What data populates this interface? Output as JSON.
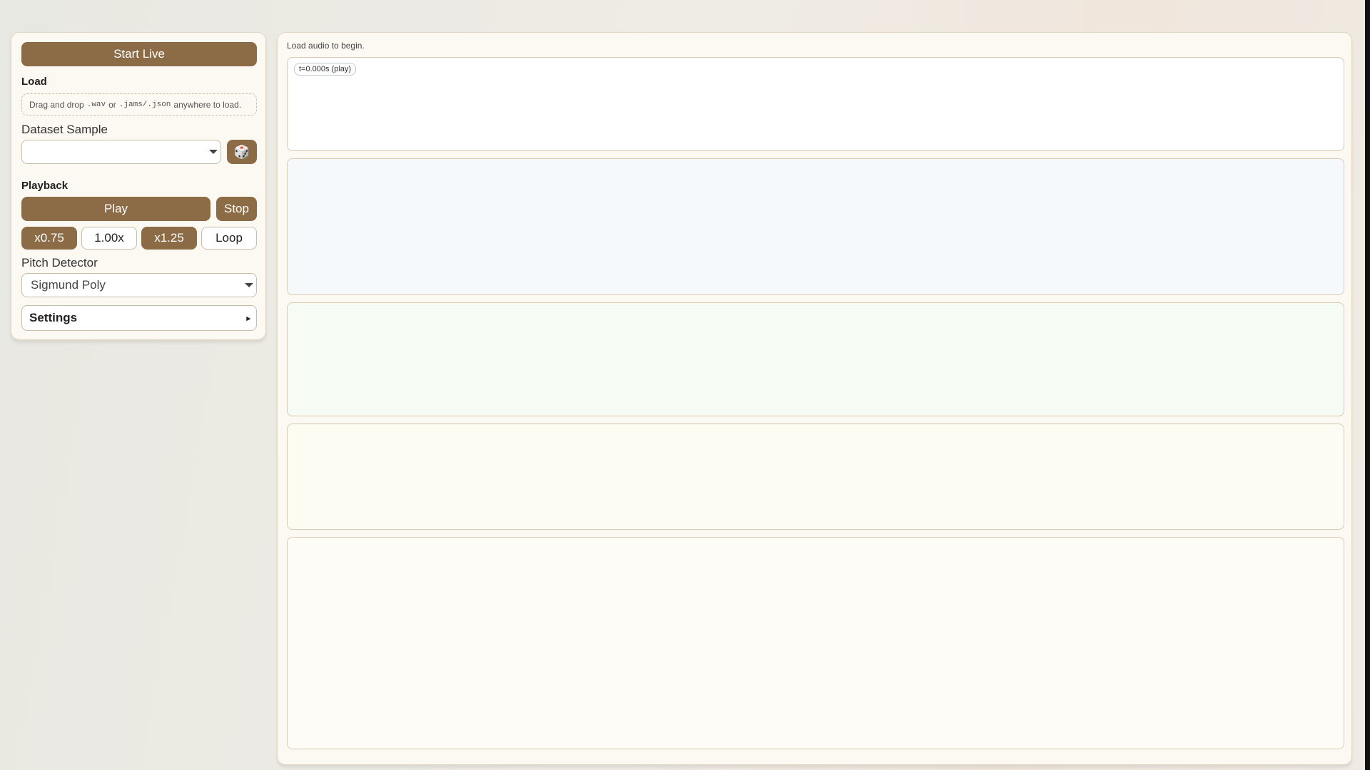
{
  "sidebar": {
    "start_live": "Start Live",
    "load_heading": "Load",
    "drop_text_1": "Drag and drop",
    "drop_ext_1": ".wav",
    "drop_text_2": "or",
    "drop_ext_2": ".jams/.json",
    "drop_text_3": "anywhere to load.",
    "dataset_label": "Dataset Sample",
    "dataset_value": "",
    "random_icon": "dice-icon",
    "playback_heading": "Playback",
    "play": "Play",
    "stop": "Stop",
    "speed_down": "x0.75",
    "speed_current": "1.00x",
    "speed_up": "x1.25",
    "loop": "Loop",
    "pitch_label": "Pitch Detector",
    "pitch_value": "Sigmund Poly",
    "settings": "Settings",
    "settings_arrow": "▸"
  },
  "main": {
    "status": "Load audio to begin.",
    "time_badge": "t=0.000s (play)"
  },
  "colors": {
    "accent": "#8c6c46",
    "panel": "#fcf9f3"
  }
}
